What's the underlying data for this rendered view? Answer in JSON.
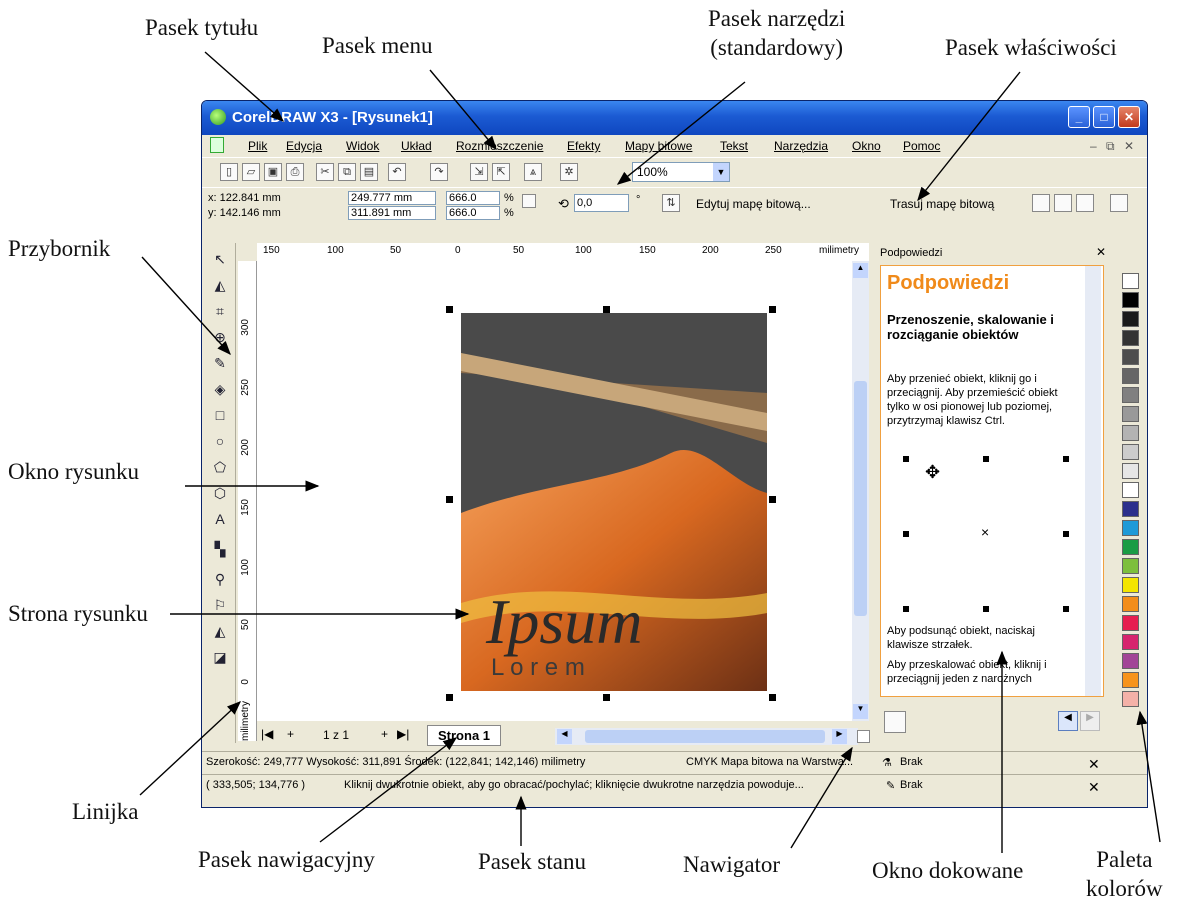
{
  "callouts": {
    "title_bar": "Pasek tytułu",
    "menu_bar": "Pasek menu",
    "toolbar_standard": "Pasek narzędzi\n(standardowy)",
    "property_bar": "Pasek właściwości",
    "toolbox": "Przybornik",
    "drawing_window": "Okno rysunku",
    "drawing_page": "Strona rysunku",
    "ruler": "Linijka",
    "nav_bar": "Pasek nawigacyjny",
    "status_bar": "Pasek stanu",
    "navigator": "Nawigator",
    "docker_window": "Okno dokowane",
    "color_palette": "Paleta\nkolorów"
  },
  "window": {
    "title": "CorelDRAW X3 - [Rysunek1]",
    "menu": [
      "Plik",
      "Edycja",
      "Widok",
      "Układ",
      "Rozmieszczenie",
      "Efekty",
      "Mapy bitowe",
      "Tekst",
      "Narzędzia",
      "Okno",
      "Pomoc"
    ],
    "zoom": "100%",
    "props": {
      "x": "x: 122.841 mm",
      "y": "y: 142.146 mm",
      "w": "249.777 mm",
      "h": "311.891 mm",
      "sx": "666.0",
      "sy": "666.0",
      "pct1": "%",
      "pct2": "%",
      "angle": "0,0",
      "deg": "°",
      "edit_bitmap": "Edytuj mapę bitową...",
      "trace_bitmap": "Trasuj mapę bitową"
    },
    "ruler_top": [
      "150",
      "100",
      "50",
      "0",
      "50",
      "100",
      "150",
      "200",
      "250",
      "milimetry"
    ],
    "ruler_left": [
      "300",
      "250",
      "200",
      "150",
      "100",
      "50",
      "0",
      "milimetry"
    ],
    "poster_text1": "Ipsum",
    "poster_text2": "L o r e m",
    "nav": {
      "pages": "1 z 1",
      "tab": "Strona 1"
    },
    "docker": {
      "header": "Podpowiedzi",
      "title": "Podpowiedzi",
      "heading": "Przenoszenie, skalowanie i rozciąganie obiektów",
      "bullet1": "Aby przenieć obiekt, kliknij go i przeciągnij. Aby przemieścić obiekt tylko w osi pionowej lub poziomej, przytrzymaj klawisz Ctrl.",
      "bullet2": "Aby podsunąć obiekt, naciskaj klawisze strzałek.",
      "bullet3": "Aby przeskalować obiekt, kliknij i przeciągnij jeden z narożnych"
    },
    "status": {
      "line1": "Szerokość: 249,777  Wysokość: 311,891  Środek: (122,841; 142,146) milimetry",
      "line1b": "CMYK Mapa bitowa na Warstwa...",
      "fill1": "Brak",
      "line2": "( 333,505; 134,776 )",
      "line2b": "Kliknij dwukrotnie obiekt, aby go obracać/pochylać; kliknięcie dwukrotne narzędzia powoduje...",
      "fill2": "Brak"
    },
    "palette": [
      "#ffffff",
      "#000000",
      "#1a1a1a",
      "#333333",
      "#4d4d4d",
      "#666666",
      "#808080",
      "#999999",
      "#b3b3b3",
      "#cccccc",
      "#e6e6e6",
      "#ffffff",
      "#2b2f8c",
      "#1e9ad8",
      "#1a9c45",
      "#7dbf3c",
      "#f3e500",
      "#f28d1a",
      "#e61e50",
      "#d6246e",
      "#a24597",
      "#f7941d",
      "#f4b1a8"
    ]
  }
}
